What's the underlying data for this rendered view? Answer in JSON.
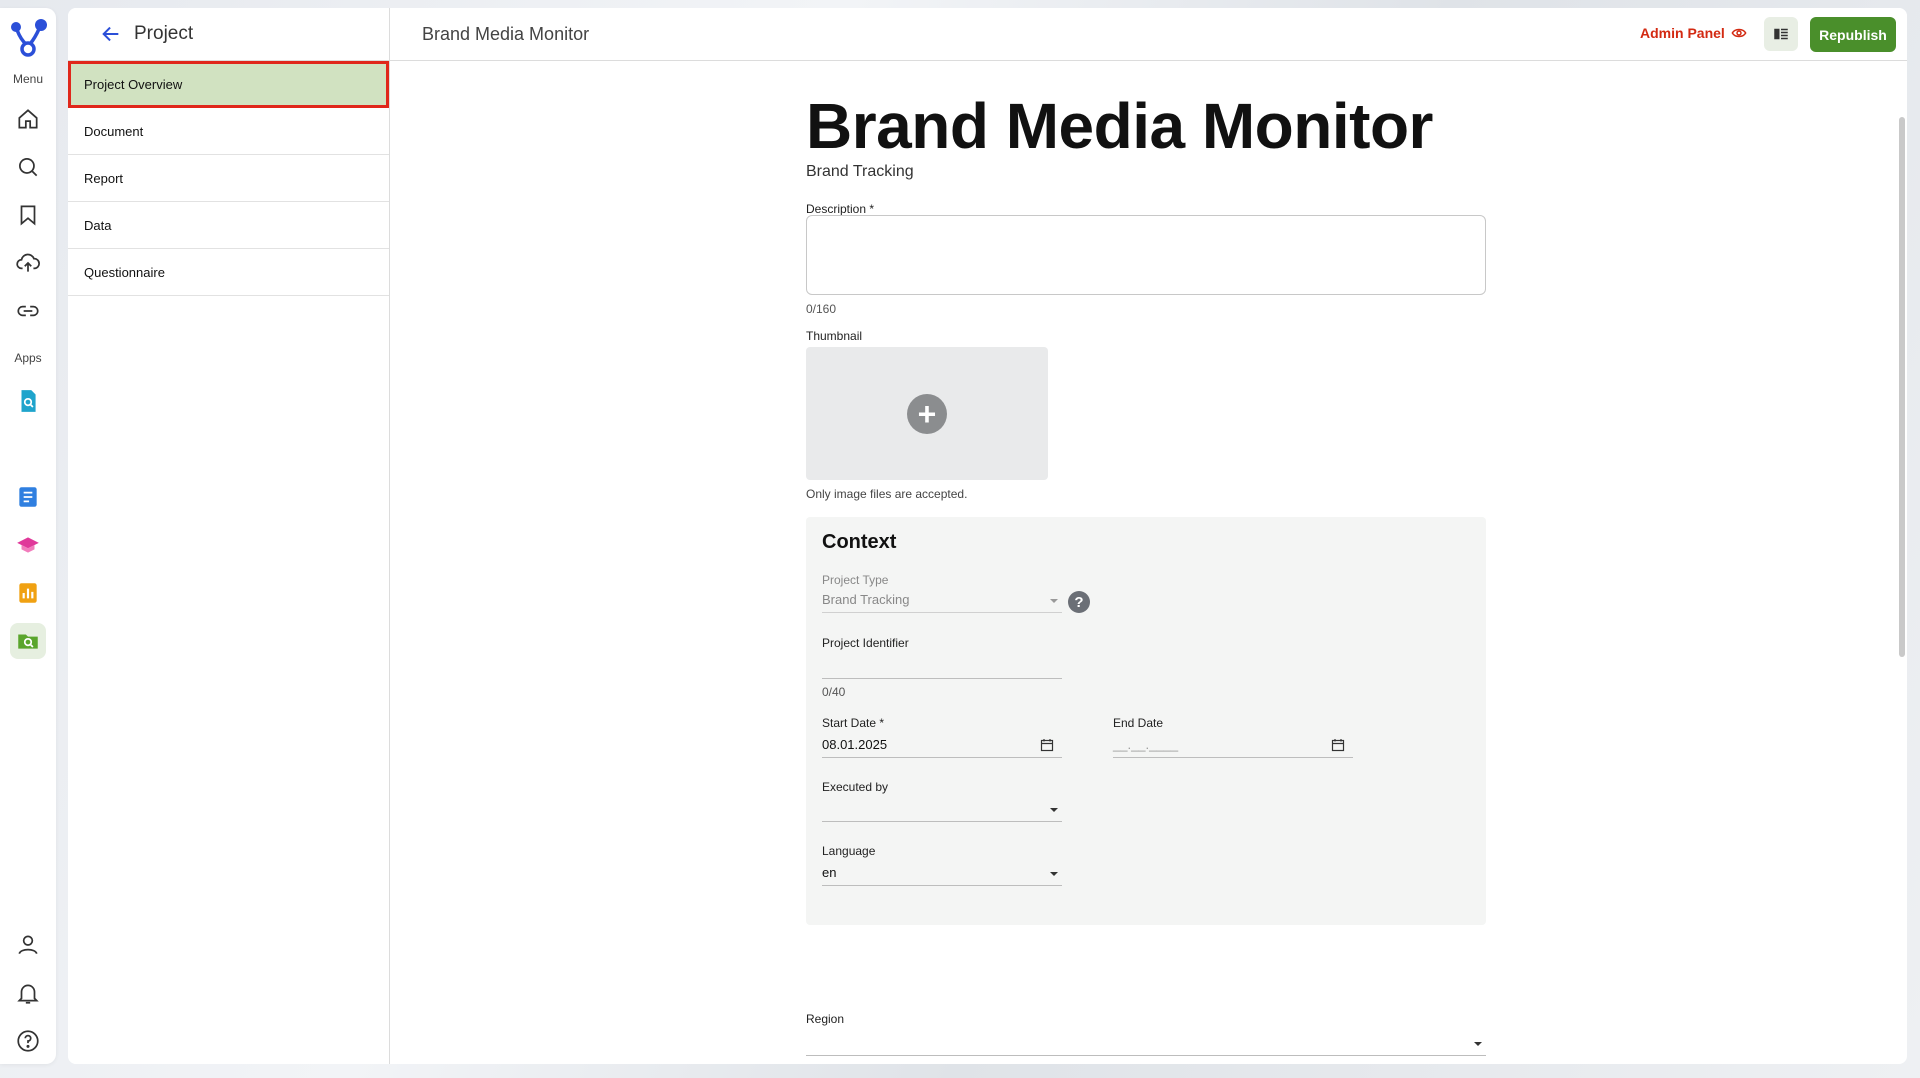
{
  "rail": {
    "menu_caption": "Menu",
    "apps_caption": "Apps",
    "menu_items": [
      {
        "name": "home-icon"
      },
      {
        "name": "search-icon"
      },
      {
        "name": "bookmark-icon"
      },
      {
        "name": "cloud-upload-icon"
      },
      {
        "name": "link-icon"
      }
    ],
    "app_items": [
      {
        "name": "doc-search-app-icon",
        "color": "#1fa4cc"
      },
      {
        "name": "moon-app-icon",
        "color": "#5b6fd6"
      },
      {
        "name": "form-app-icon",
        "color": "#2f7fe0"
      },
      {
        "name": "graduation-cap-app-icon",
        "color": "#e0389a"
      },
      {
        "name": "bar-chart-app-icon",
        "color": "#f0a112"
      },
      {
        "name": "folder-search-app-icon",
        "color": "#5aa52c"
      }
    ],
    "bottom_items": [
      {
        "name": "user-icon"
      },
      {
        "name": "bell-icon"
      },
      {
        "name": "help-circle-icon"
      }
    ]
  },
  "header": {
    "back_label": "Project",
    "title": "Brand Media Monitor",
    "admin_panel_label": "Admin Panel",
    "republish_label": "Republish"
  },
  "subnav": {
    "items": [
      {
        "label": "Project Overview",
        "active": true
      },
      {
        "label": "Document"
      },
      {
        "label": "Report"
      },
      {
        "label": "Data"
      },
      {
        "label": "Questionnaire"
      }
    ]
  },
  "page": {
    "title": "Brand Media Monitor",
    "subtitle": "Brand Tracking",
    "description_label": "Description *",
    "description_value": "",
    "description_counter": "0/160",
    "thumbnail_label": "Thumbnail",
    "thumbnail_hint": "Only image files are accepted.",
    "context": {
      "title": "Context",
      "project_type_label": "Project Type",
      "project_type_value": "Brand Tracking",
      "project_identifier_label": "Project Identifier",
      "project_identifier_value": "",
      "project_identifier_counter": "0/40",
      "start_date_label": "Start Date *",
      "start_date_value": "08.01.2025",
      "end_date_label": "End Date",
      "end_date_placeholder": "__.__.____",
      "executed_by_label": "Executed by",
      "executed_by_value": "",
      "language_label": "Language",
      "language_value": "en"
    },
    "region_label": "Region",
    "region_value": ""
  },
  "colors": {
    "accent_green": "#4a8f2b",
    "active_nav_bg": "#d1e2c1",
    "highlight_border": "#e0271b",
    "admin_red": "#d32a12",
    "logo_blue": "#2b4fd8"
  }
}
